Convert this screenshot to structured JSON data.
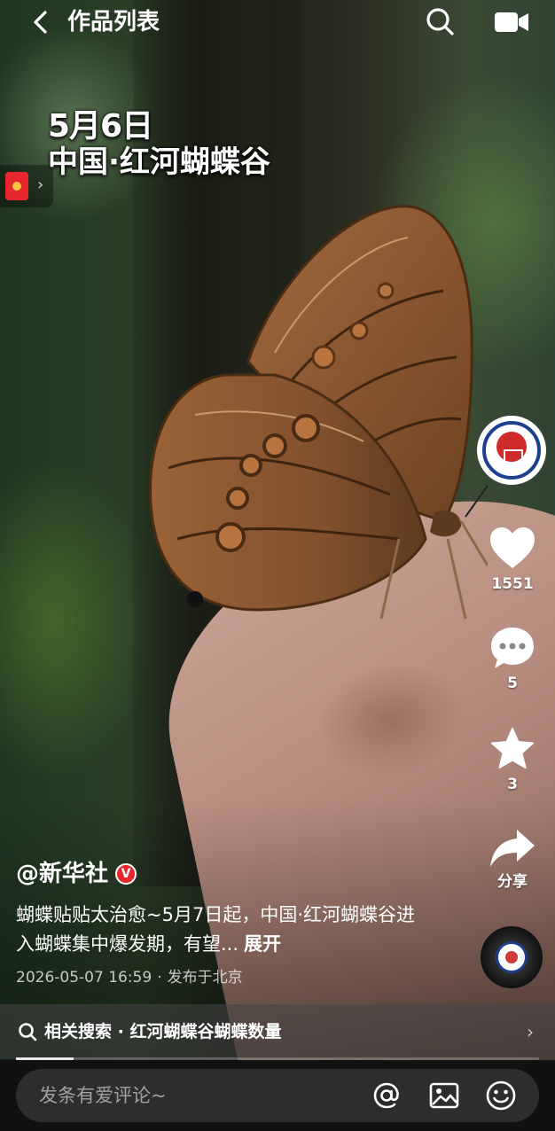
{
  "header": {
    "title": "作品列表",
    "back_icon": "chevron-left-icon",
    "search_icon": "search-icon",
    "video_icon": "video-camera-icon"
  },
  "video_overlay": {
    "date": "5月6日",
    "place": "中国·红河蝴蝶谷"
  },
  "red_packet": {
    "icon": "red-envelope-icon",
    "arrow": "›"
  },
  "rail": {
    "avatar_icon": "xinhua-logo-icon",
    "like_count": "1551",
    "comment_count": "5",
    "favorite_count": "3",
    "share_label": "分享"
  },
  "post": {
    "author": "@新华社",
    "verified_mark": "V",
    "caption": "蝴蝶贴贴太治愈~5月7日起，中国·红河蝴蝶谷进入蝴蝶集中爆发期，有望...",
    "expand_label": "展开",
    "datetime": "2026-05-07 16:59",
    "separator": "·",
    "location": "发布于北京"
  },
  "related_search": {
    "label": "相关搜索 · 红河蝴蝶谷蝴蝶数量",
    "chevron": "›"
  },
  "playback": {
    "progress_fraction": 0.11
  },
  "comment_bar": {
    "placeholder": "发条有爱评论~",
    "mention_icon": "at-icon",
    "image_icon": "image-icon",
    "emoji_icon": "emoji-icon"
  },
  "colors": {
    "accent_red": "#e8262d",
    "text_white": "#ffffff",
    "comment_bg": "#2d2d2d"
  }
}
